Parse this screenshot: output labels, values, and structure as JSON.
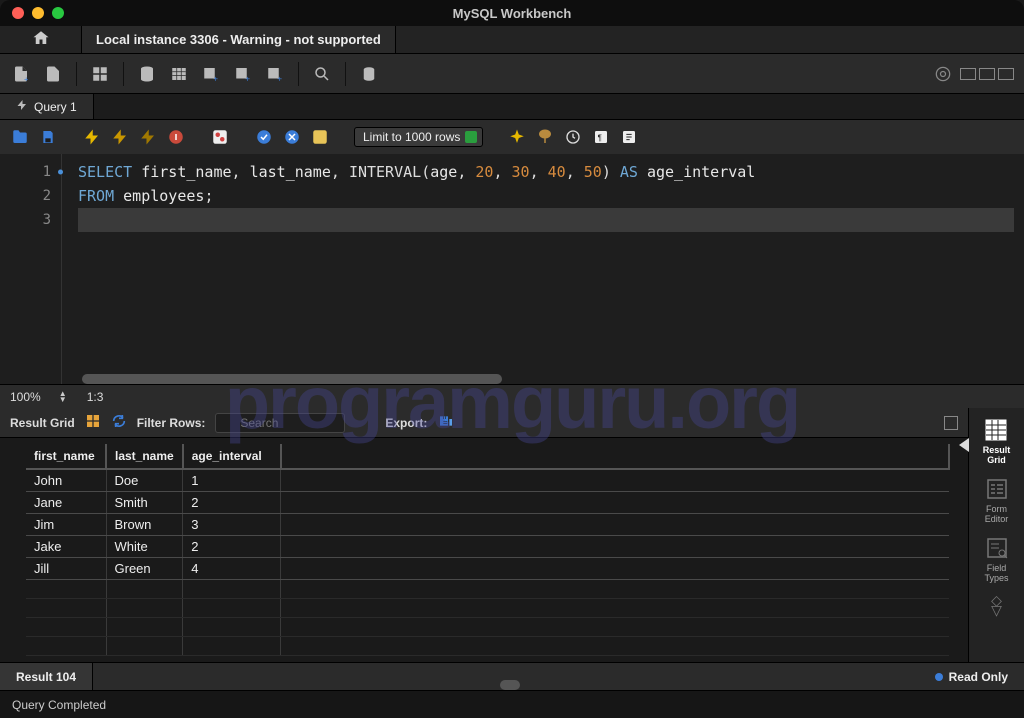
{
  "title": "MySQL Workbench",
  "window_tab": "Local instance 3306 - Warning - not supported",
  "query_tab": "Query 1",
  "limit_select": "Limit to 1000 rows",
  "sql": {
    "lines": [
      {
        "segments": [
          {
            "t": "kw",
            "v": "SELECT "
          },
          {
            "t": "ident",
            "v": "first_name"
          },
          {
            "t": "plain",
            "v": ", "
          },
          {
            "t": "ident",
            "v": "last_name"
          },
          {
            "t": "plain",
            "v": ", "
          },
          {
            "t": "func",
            "v": "INTERVAL"
          },
          {
            "t": "plain",
            "v": "("
          },
          {
            "t": "ident",
            "v": "age"
          },
          {
            "t": "plain",
            "v": ", "
          },
          {
            "t": "num",
            "v": "20"
          },
          {
            "t": "plain",
            "v": ", "
          },
          {
            "t": "num",
            "v": "30"
          },
          {
            "t": "plain",
            "v": ", "
          },
          {
            "t": "num",
            "v": "40"
          },
          {
            "t": "plain",
            "v": ", "
          },
          {
            "t": "num",
            "v": "50"
          },
          {
            "t": "plain",
            "v": ") "
          },
          {
            "t": "kw",
            "v": "AS "
          },
          {
            "t": "ident",
            "v": "age_interval"
          }
        ]
      },
      {
        "segments": [
          {
            "t": "kw",
            "v": "FROM "
          },
          {
            "t": "ident",
            "v": "employees"
          },
          {
            "t": "plain",
            "v": ";"
          }
        ]
      },
      {
        "segments": []
      }
    ]
  },
  "zoom": "100%",
  "cursor": "1:3",
  "result_toolbar": {
    "label": "Result Grid",
    "filter_label": "Filter Rows:",
    "search_placeholder": "Search",
    "export_label": "Export:"
  },
  "columns": [
    "first_name",
    "last_name",
    "age_interval"
  ],
  "rows": [
    [
      "John",
      "Doe",
      "1"
    ],
    [
      "Jane",
      "Smith",
      "2"
    ],
    [
      "Jim",
      "Brown",
      "3"
    ],
    [
      "Jake",
      "White",
      "2"
    ],
    [
      "Jill",
      "Green",
      "4"
    ]
  ],
  "right_pane": {
    "result_grid": "Result\nGrid",
    "form_editor": "Form\nEditor",
    "field_types": "Field\nTypes"
  },
  "result_tab": "Result 104",
  "read_only": "Read Only",
  "status": "Query Completed",
  "watermark": "programguru.org"
}
